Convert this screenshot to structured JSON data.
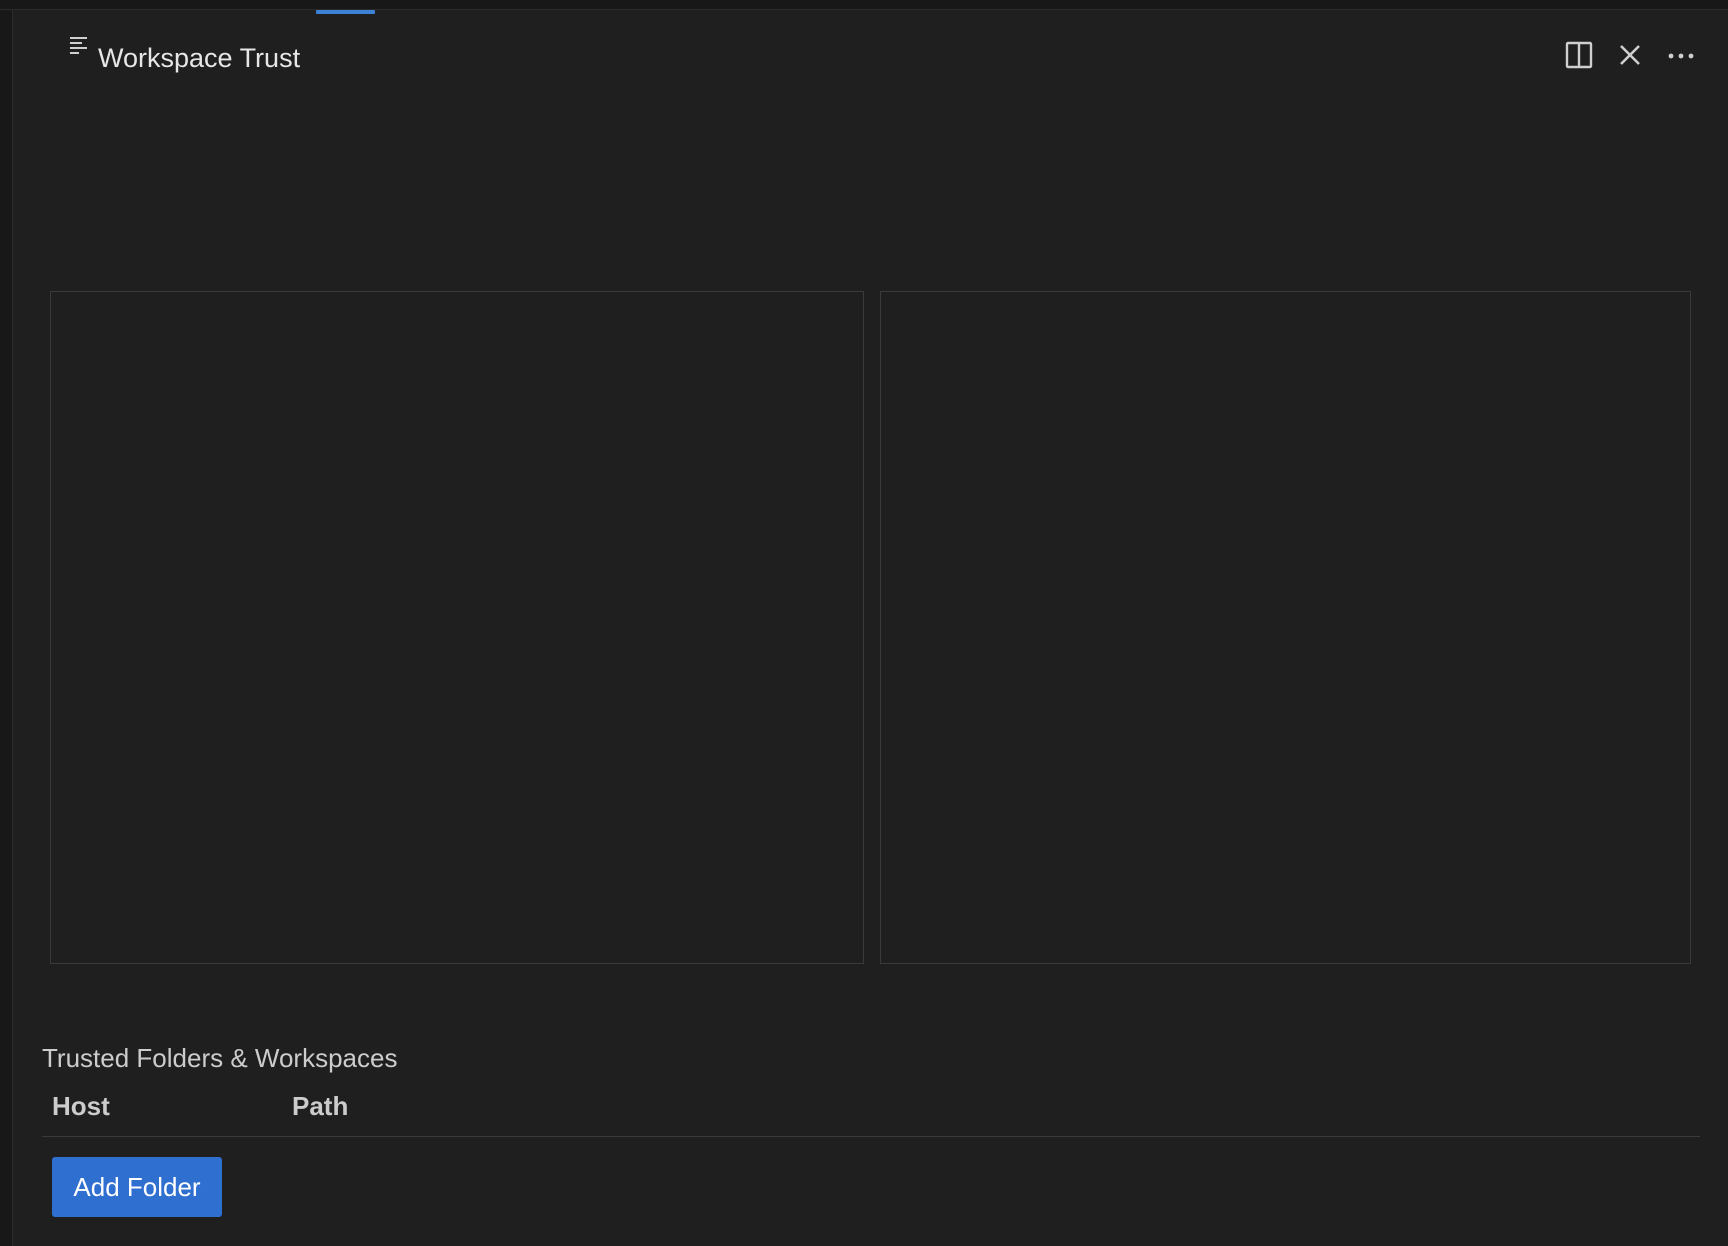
{
  "editor_tab": {
    "title": "Workspace Trust",
    "icon": "file-text-lines-icon"
  },
  "editor_actions": {
    "split": {
      "icon": "split-editor-icon",
      "label": "Split Editor"
    },
    "close": {
      "icon": "close-icon",
      "label": "Close"
    },
    "more": {
      "icon": "more-actions-icon",
      "label": "More Actions..."
    }
  },
  "trusted_section": {
    "title": "Trusted Folders & Workspaces",
    "columns": [
      "Host",
      "Path"
    ],
    "rows": [],
    "add_button_label": "Add Folder"
  },
  "colors": {
    "background": "#1f1f1f",
    "accent": "#2f6fd0",
    "active_indicator": "#3b82d6",
    "border": "#3a3a3a"
  }
}
